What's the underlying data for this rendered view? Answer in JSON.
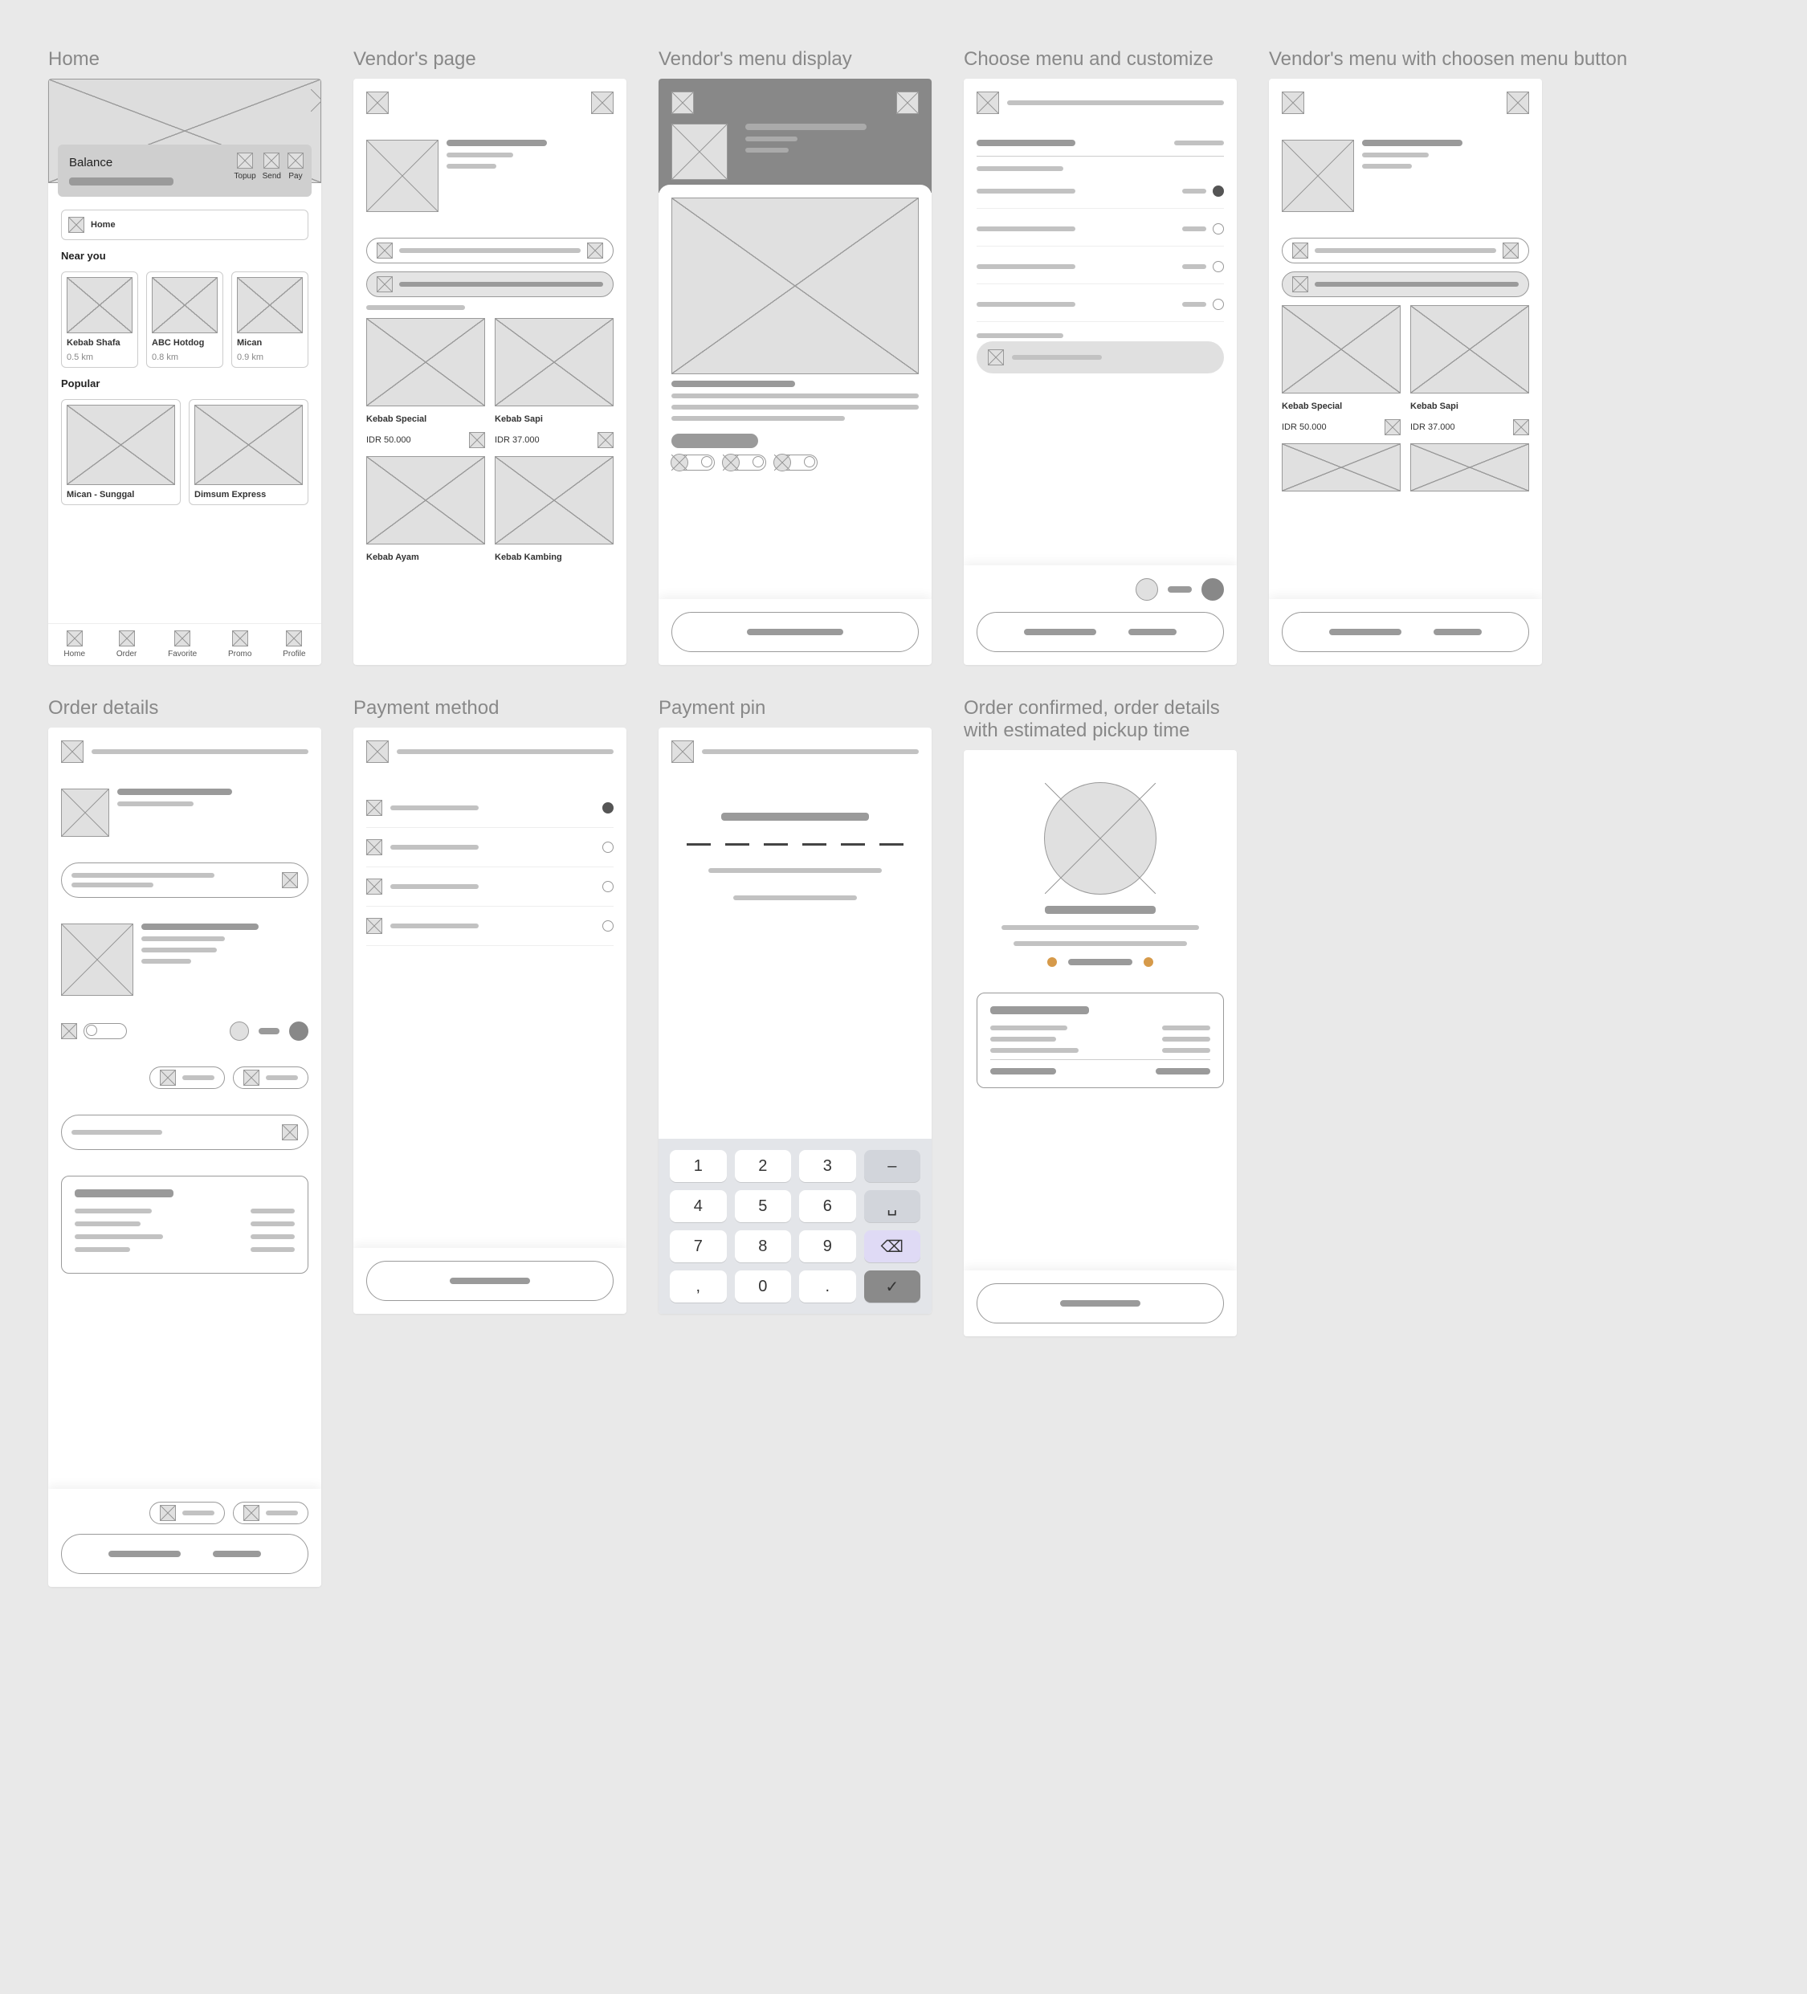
{
  "frames": {
    "home": "Home",
    "vendor": "Vendor's page",
    "menu_display": "Vendor's menu display",
    "customize": "Choose menu and customize",
    "menu_chosen": "Vendor's menu with choosen menu button",
    "order_details": "Order details",
    "payment_method": "Payment method",
    "payment_pin": "Payment pin",
    "order_confirmed": "Order confirmed, order details with estimated pickup time"
  },
  "home": {
    "balance_label": "Balance",
    "actions": {
      "topup": "Topup",
      "send": "Send",
      "pay": "Pay"
    },
    "tab_home": "Home",
    "near_you": "Near you",
    "popular": "Popular",
    "near": [
      {
        "name": "Kebab Shafa",
        "dist": "0.5 km"
      },
      {
        "name": "ABC Hotdog",
        "dist": "0.8 km"
      },
      {
        "name": "Mican",
        "dist": "0.9 km"
      }
    ],
    "popular_items": [
      "Mican - Sunggal",
      "Dimsum Express"
    ],
    "nav": [
      "Home",
      "Order",
      "Favorite",
      "Promo",
      "Profile"
    ]
  },
  "vendor": {
    "products": [
      {
        "name": "Kebab Special",
        "price": "IDR 50.000"
      },
      {
        "name": "Kebab Sapi",
        "price": "IDR 37.000"
      },
      {
        "name": "Kebab Ayam",
        "price": ""
      },
      {
        "name": "Kebab Kambing",
        "price": ""
      }
    ]
  },
  "keypad": [
    "1",
    "2",
    "3",
    "–",
    "4",
    "5",
    "6",
    "␣",
    "7",
    "8",
    "9",
    "⌫",
    ",",
    "0",
    ".",
    "✓"
  ]
}
